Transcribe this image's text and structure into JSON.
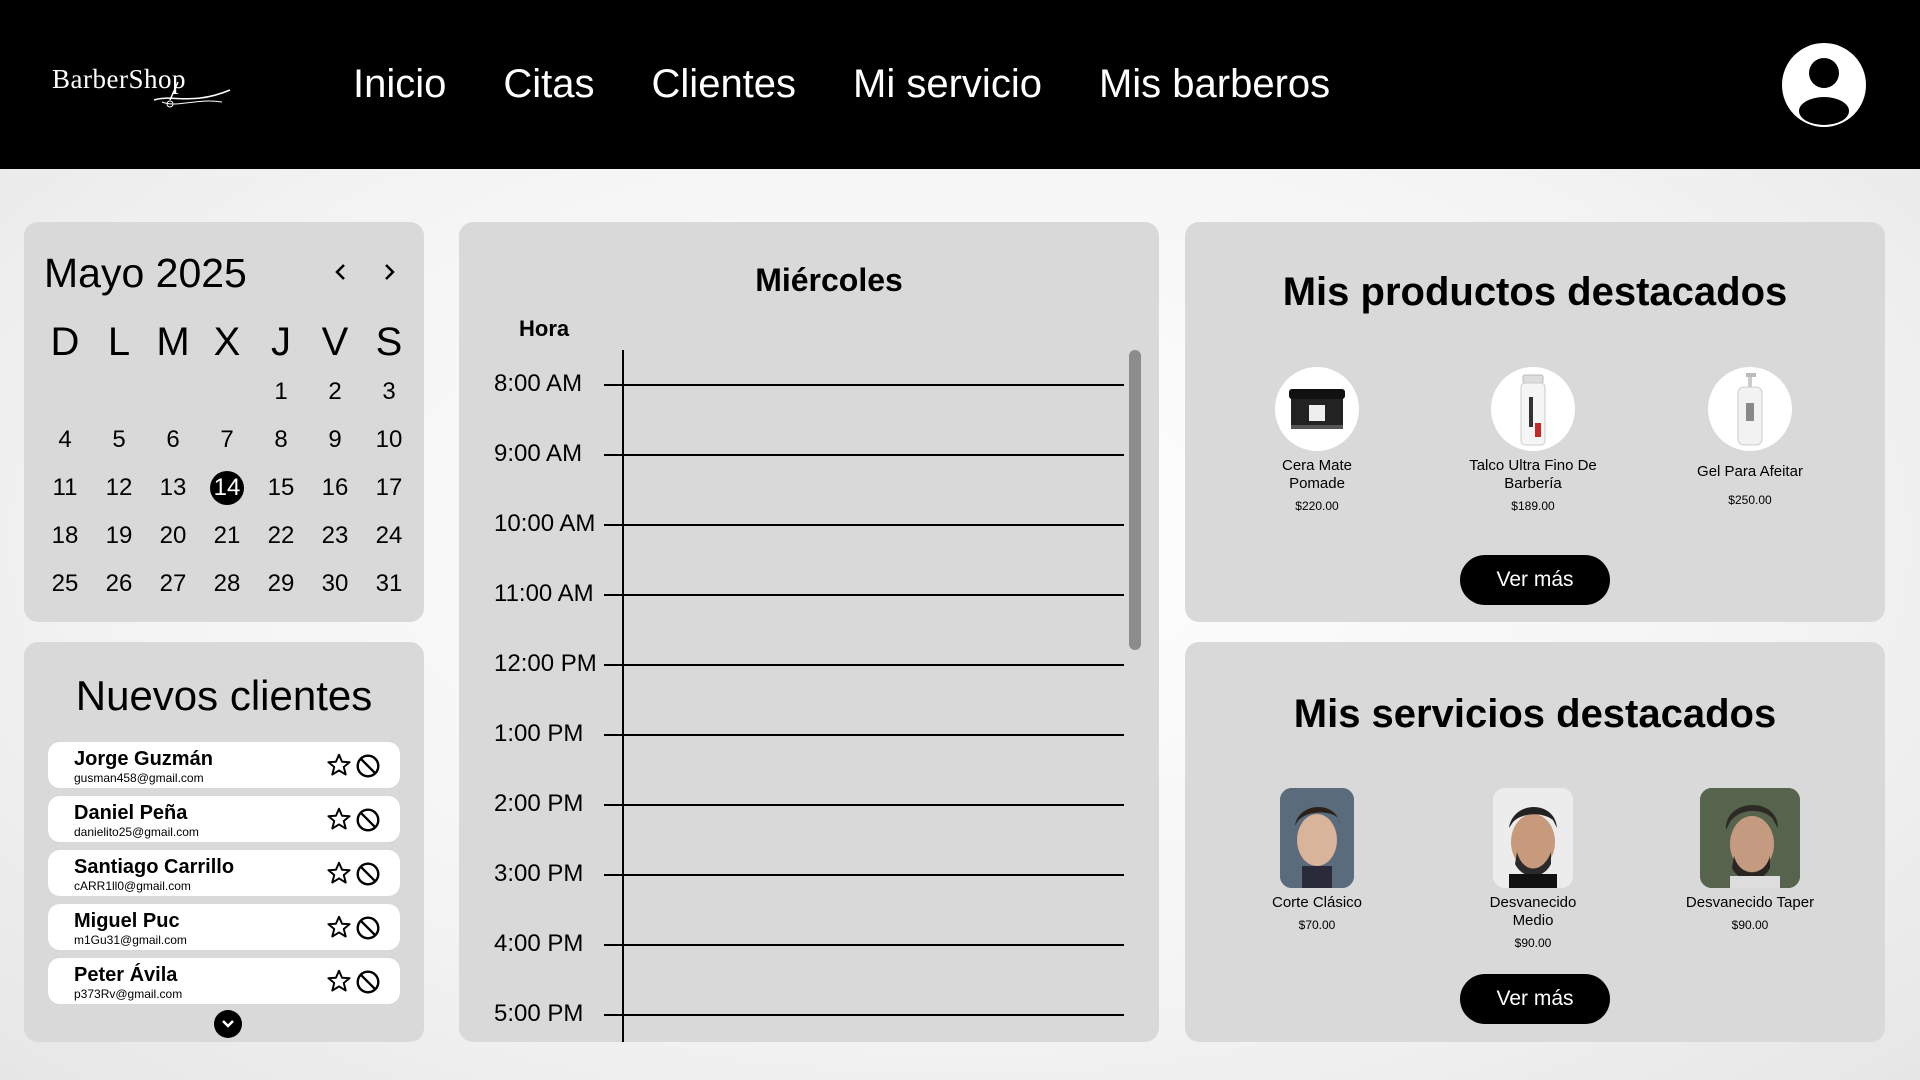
{
  "header": {
    "logo_text": "BarberShop",
    "nav": [
      "Inicio",
      "Citas",
      "Clientes",
      "Mi servicio",
      "Mis barberos"
    ]
  },
  "calendar": {
    "title": "Mayo 2025",
    "weekdays": [
      "D",
      "L",
      "M",
      "X",
      "J",
      "V",
      "S"
    ],
    "selected_day": "14",
    "weeks": [
      [
        "",
        "",
        "",
        "",
        "1",
        "2",
        "3"
      ],
      [
        "4",
        "5",
        "6",
        "7",
        "8",
        "9",
        "10"
      ],
      [
        "11",
        "12",
        "13",
        "14",
        "15",
        "16",
        "17"
      ],
      [
        "18",
        "19",
        "20",
        "21",
        "22",
        "23",
        "24"
      ],
      [
        "25",
        "26",
        "27",
        "28",
        "29",
        "30",
        "31"
      ]
    ]
  },
  "new_clients": {
    "title": "Nuevos clientes",
    "items": [
      {
        "name": "Jorge Guzmán",
        "email": "gusman458@gmail.com"
      },
      {
        "name": "Daniel Peña",
        "email": "danielito25@gmail.com"
      },
      {
        "name": "Santiago Carrillo",
        "email": "cARR1ll0@gmail.com"
      },
      {
        "name": "Miguel Puc",
        "email": "m1Gu31@gmail.com"
      },
      {
        "name": "Peter Ávila",
        "email": "p373Rv@gmail.com"
      }
    ]
  },
  "schedule": {
    "day": "Miércoles",
    "hour_header": "Hora",
    "slots": [
      "8:00 AM",
      "9:00 AM",
      "10:00 AM",
      "11:00 AM",
      "12:00 PM",
      "1:00 PM",
      "2:00 PM",
      "3:00 PM",
      "4:00 PM",
      "5:00 PM"
    ]
  },
  "products": {
    "title": "Mis productos destacados",
    "items": [
      {
        "name": "Cera Mate Pomade",
        "price": "$220.00",
        "icon": "pomade-jar-icon"
      },
      {
        "name": "Talco Ultra Fino De Barbería",
        "price": "$189.00",
        "icon": "talc-bottle-icon"
      },
      {
        "name": "Gel Para Afeitar",
        "price": "$250.00",
        "icon": "gel-pump-bottle-icon"
      }
    ],
    "more_label": "Ver más"
  },
  "services": {
    "title": "Mis servicios destacados",
    "items": [
      {
        "name": "Corte Clásico",
        "price": "$70.00"
      },
      {
        "name": "Desvanecido Medio",
        "price": "$90.00"
      },
      {
        "name": "Desvanecido Taper",
        "price": "$90.00"
      }
    ],
    "more_label": "Ver más"
  }
}
